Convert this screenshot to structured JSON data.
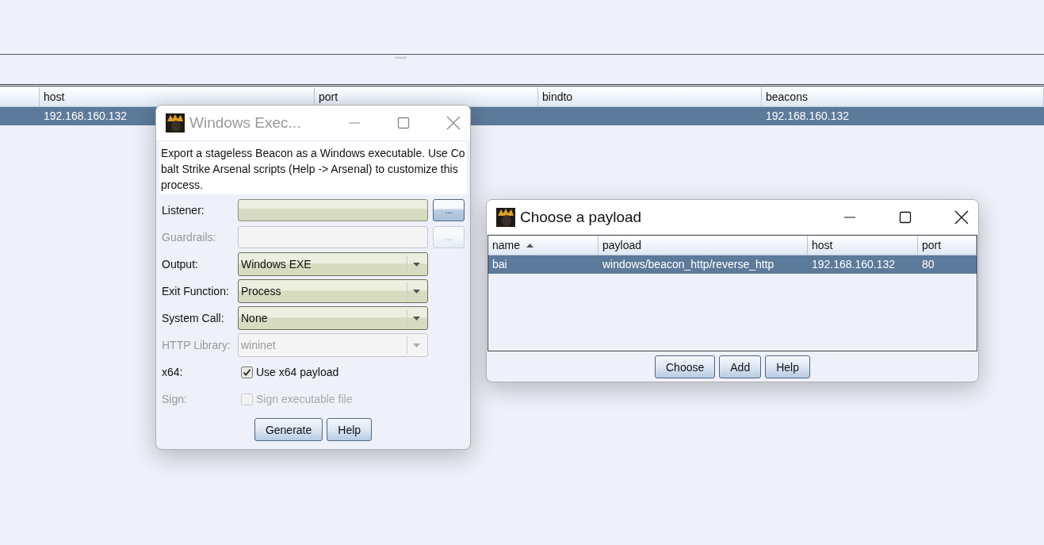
{
  "main_table": {
    "columns": [
      "host",
      "port",
      "bindto",
      "beacons"
    ],
    "rows": [
      {
        "host": "192.168.160.132",
        "beacons": "192.168.160.132",
        "selected": true
      }
    ]
  },
  "export_dialog": {
    "title": "Windows Exec...",
    "active": false,
    "description": "Export a stageless Beacon as a Windows executable. Use Cobalt Strike Arsenal scripts (Help -> Arsenal) to customize this process.",
    "fields": [
      {
        "kind": "text",
        "label": "Listener:",
        "disabled": false,
        "browse_label": "..."
      },
      {
        "kind": "text",
        "label": "Guardrails:",
        "disabled": true,
        "browse_label": "..."
      },
      {
        "kind": "combo",
        "label": "Output:",
        "value": "Windows EXE",
        "disabled": false
      },
      {
        "kind": "combo",
        "label": "Exit Function:",
        "value": "Process",
        "disabled": false
      },
      {
        "kind": "combo",
        "label": "System Call:",
        "value": "None",
        "disabled": false
      },
      {
        "kind": "combo",
        "label": "HTTP Library:",
        "value": "wininet",
        "disabled": true
      },
      {
        "kind": "checkbox",
        "label": "x64:",
        "text": "Use x64 payload",
        "checked": true,
        "disabled": false
      },
      {
        "kind": "checkbox",
        "label": "Sign:",
        "text": "Sign executable file",
        "checked": false,
        "disabled": true
      }
    ],
    "buttons": [
      "Generate",
      "Help"
    ]
  },
  "payload_dialog": {
    "title": "Choose a payload",
    "active": true,
    "columns": [
      {
        "label": "name",
        "sorted": true
      },
      {
        "label": "payload",
        "sorted": false
      },
      {
        "label": "host",
        "sorted": false
      },
      {
        "label": "port",
        "sorted": false
      }
    ],
    "rows": [
      {
        "cells": [
          "bai",
          "windows/beacon_http/reverse_http",
          "192.168.160.132",
          "80"
        ],
        "selected": true
      }
    ],
    "buttons": [
      "Choose",
      "Add",
      "Help"
    ]
  }
}
